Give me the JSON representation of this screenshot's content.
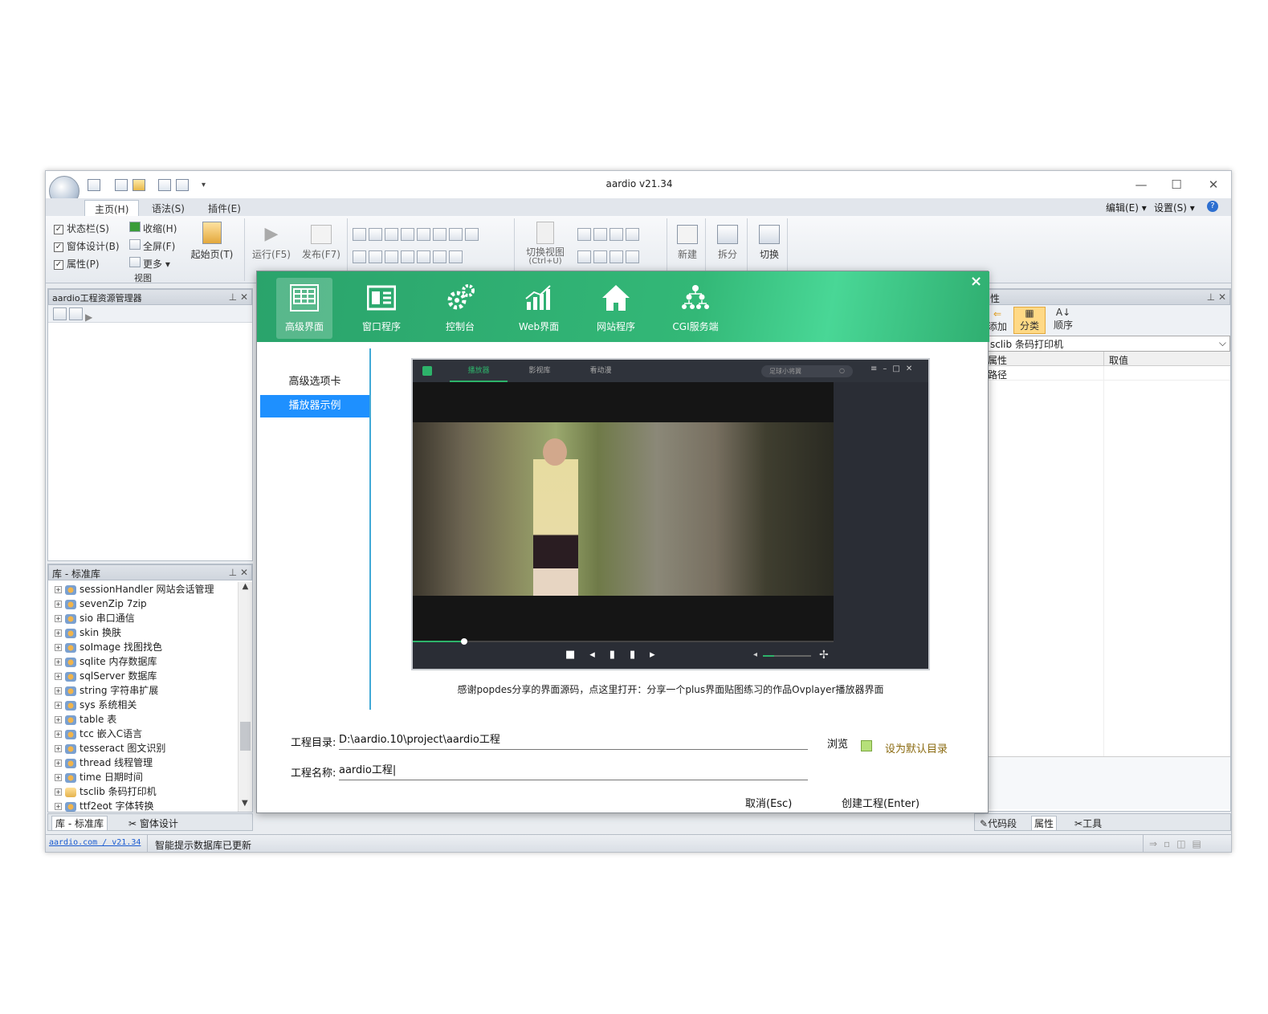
{
  "window": {
    "title": "aardio v21.34"
  },
  "ribbon": {
    "tabs": [
      {
        "label": "主页(H)"
      },
      {
        "label": "语法(S)"
      },
      {
        "label": "插件(E)"
      }
    ],
    "right_menu": {
      "edit": "编辑(E)",
      "settings": "设置(S)"
    },
    "view_group": {
      "statusbar": "状态栏(S)",
      "form_design": "窗体设计(B)",
      "properties": "属性(P)",
      "collapse": "收缩(H)",
      "fullscreen": "全屏(F)",
      "more": "更多",
      "label": "视图"
    },
    "start_page": "起始页(T)",
    "run": "运行(F5)",
    "publish": "发布(F7)",
    "switch_view": "切换视图",
    "switch_view_key": "(Ctrl+U)",
    "new": "新建",
    "split": "拆分",
    "switch": "切换"
  },
  "explorer": {
    "title": "aardio工程资源管理器"
  },
  "library": {
    "title": "库 - 标准库",
    "items": [
      {
        "label": "sessionHandler 网站会话管理"
      },
      {
        "label": "sevenZip 7zip"
      },
      {
        "label": "sio 串口通信"
      },
      {
        "label": "skin 换肤"
      },
      {
        "label": "soImage 找图找色"
      },
      {
        "label": "sqlite 内存数据库"
      },
      {
        "label": "sqlServer 数据库"
      },
      {
        "label": "string 字符串扩展"
      },
      {
        "label": "sys 系统相关"
      },
      {
        "label": "table 表"
      },
      {
        "label": "tcc 嵌入C语言"
      },
      {
        "label": "tesseract 图文识别"
      },
      {
        "label": "thread 线程管理"
      },
      {
        "label": "time 日期时间"
      },
      {
        "label": "tsclib 条码打印机"
      },
      {
        "label": "ttf2eot 字体转换"
      }
    ],
    "bottom_tabs": {
      "lib": "库 - 标准库",
      "form": "窗体设计"
    }
  },
  "props": {
    "title_partial": "性",
    "add": "添加",
    "category": "分类",
    "order": "顺序",
    "object": "sclib 条码打印机",
    "col_name": "属性",
    "col_value": "取值",
    "row1": "路径",
    "bottom_tabs": {
      "snippet": "代码段",
      "props": "属性",
      "tools": "工具"
    }
  },
  "dialog": {
    "tabs": [
      {
        "label": "高级界面"
      },
      {
        "label": "窗口程序"
      },
      {
        "label": "控制台"
      },
      {
        "label": "Web界面"
      },
      {
        "label": "网站程序"
      },
      {
        "label": "CGI服务端"
      }
    ],
    "close": "×",
    "side": [
      {
        "label": "高级选项卡"
      },
      {
        "label": "播放器示例"
      }
    ],
    "player": {
      "tabs": [
        "播放器",
        "影视库",
        "看动漫"
      ],
      "search": "足球小将翼"
    },
    "caption": "感谢popdes分享的界面源码，点这里打开：分享一个plus界面贴图练习的作品Ovplayer播放器界面",
    "dir_label": "工程目录:",
    "dir_value": "D:\\aardio.10\\project\\aardio工程",
    "browse": "浏览",
    "default_dir": "设为默认目录",
    "name_label": "工程名称:",
    "name_value": "aardio工程",
    "cancel": "取消(Esc)",
    "create": "创建工程(Enter)"
  },
  "status": {
    "link": "aardio.com / v21.34",
    "message": "智能提示数据库已更新"
  },
  "colors": {
    "accent_green": "#33b877",
    "highlight_blue": "#1e90ff"
  }
}
